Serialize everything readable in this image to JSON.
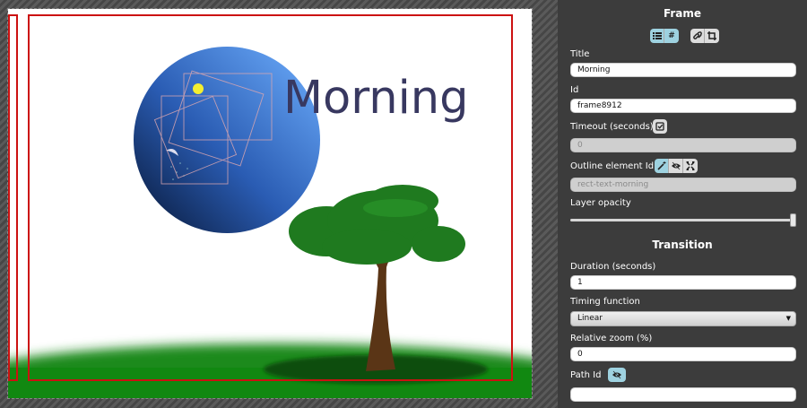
{
  "canvas": {
    "title_text": "Morning",
    "colors": {
      "frame_outline": "#cc1111",
      "grass": "#1a8a1a",
      "sky_dark": "#0b1f4a",
      "sky_light": "#6ea8ff",
      "title_color": "#383860",
      "trunk": "#5a3516",
      "foliage": "#1f7a1f"
    }
  },
  "panel": {
    "frame_section_title": "Frame",
    "frame_view_buttons": [
      {
        "icon": "list-icon",
        "active": true
      },
      {
        "icon": "hash-icon",
        "label": "#",
        "active": true
      }
    ],
    "frame_tool_buttons": [
      {
        "icon": "link-icon",
        "active": false
      },
      {
        "icon": "crop-icon",
        "active": false
      }
    ],
    "title": {
      "label": "Title",
      "value": "Morning"
    },
    "id": {
      "label": "Id",
      "value": "frame8912"
    },
    "timeout": {
      "label": "Timeout (seconds)",
      "value": "0",
      "checkbox_icon": "checkbox-checked-icon"
    },
    "outline": {
      "label": "Outline element Id",
      "value": "rect-text-morning",
      "buttons": [
        "magic-wand-icon",
        "eye-icon",
        "move-icon"
      ]
    },
    "layer_opacity": {
      "label": "Layer opacity",
      "value": 1.0
    },
    "transition_section_title": "Transition",
    "duration": {
      "label": "Duration (seconds)",
      "value": "1"
    },
    "timing": {
      "label": "Timing function",
      "value": "Linear"
    },
    "zoom": {
      "label": "Relative zoom (%)",
      "value": "0"
    },
    "path": {
      "label": "Path Id",
      "value": "",
      "button_icon": "eye-icon"
    }
  }
}
